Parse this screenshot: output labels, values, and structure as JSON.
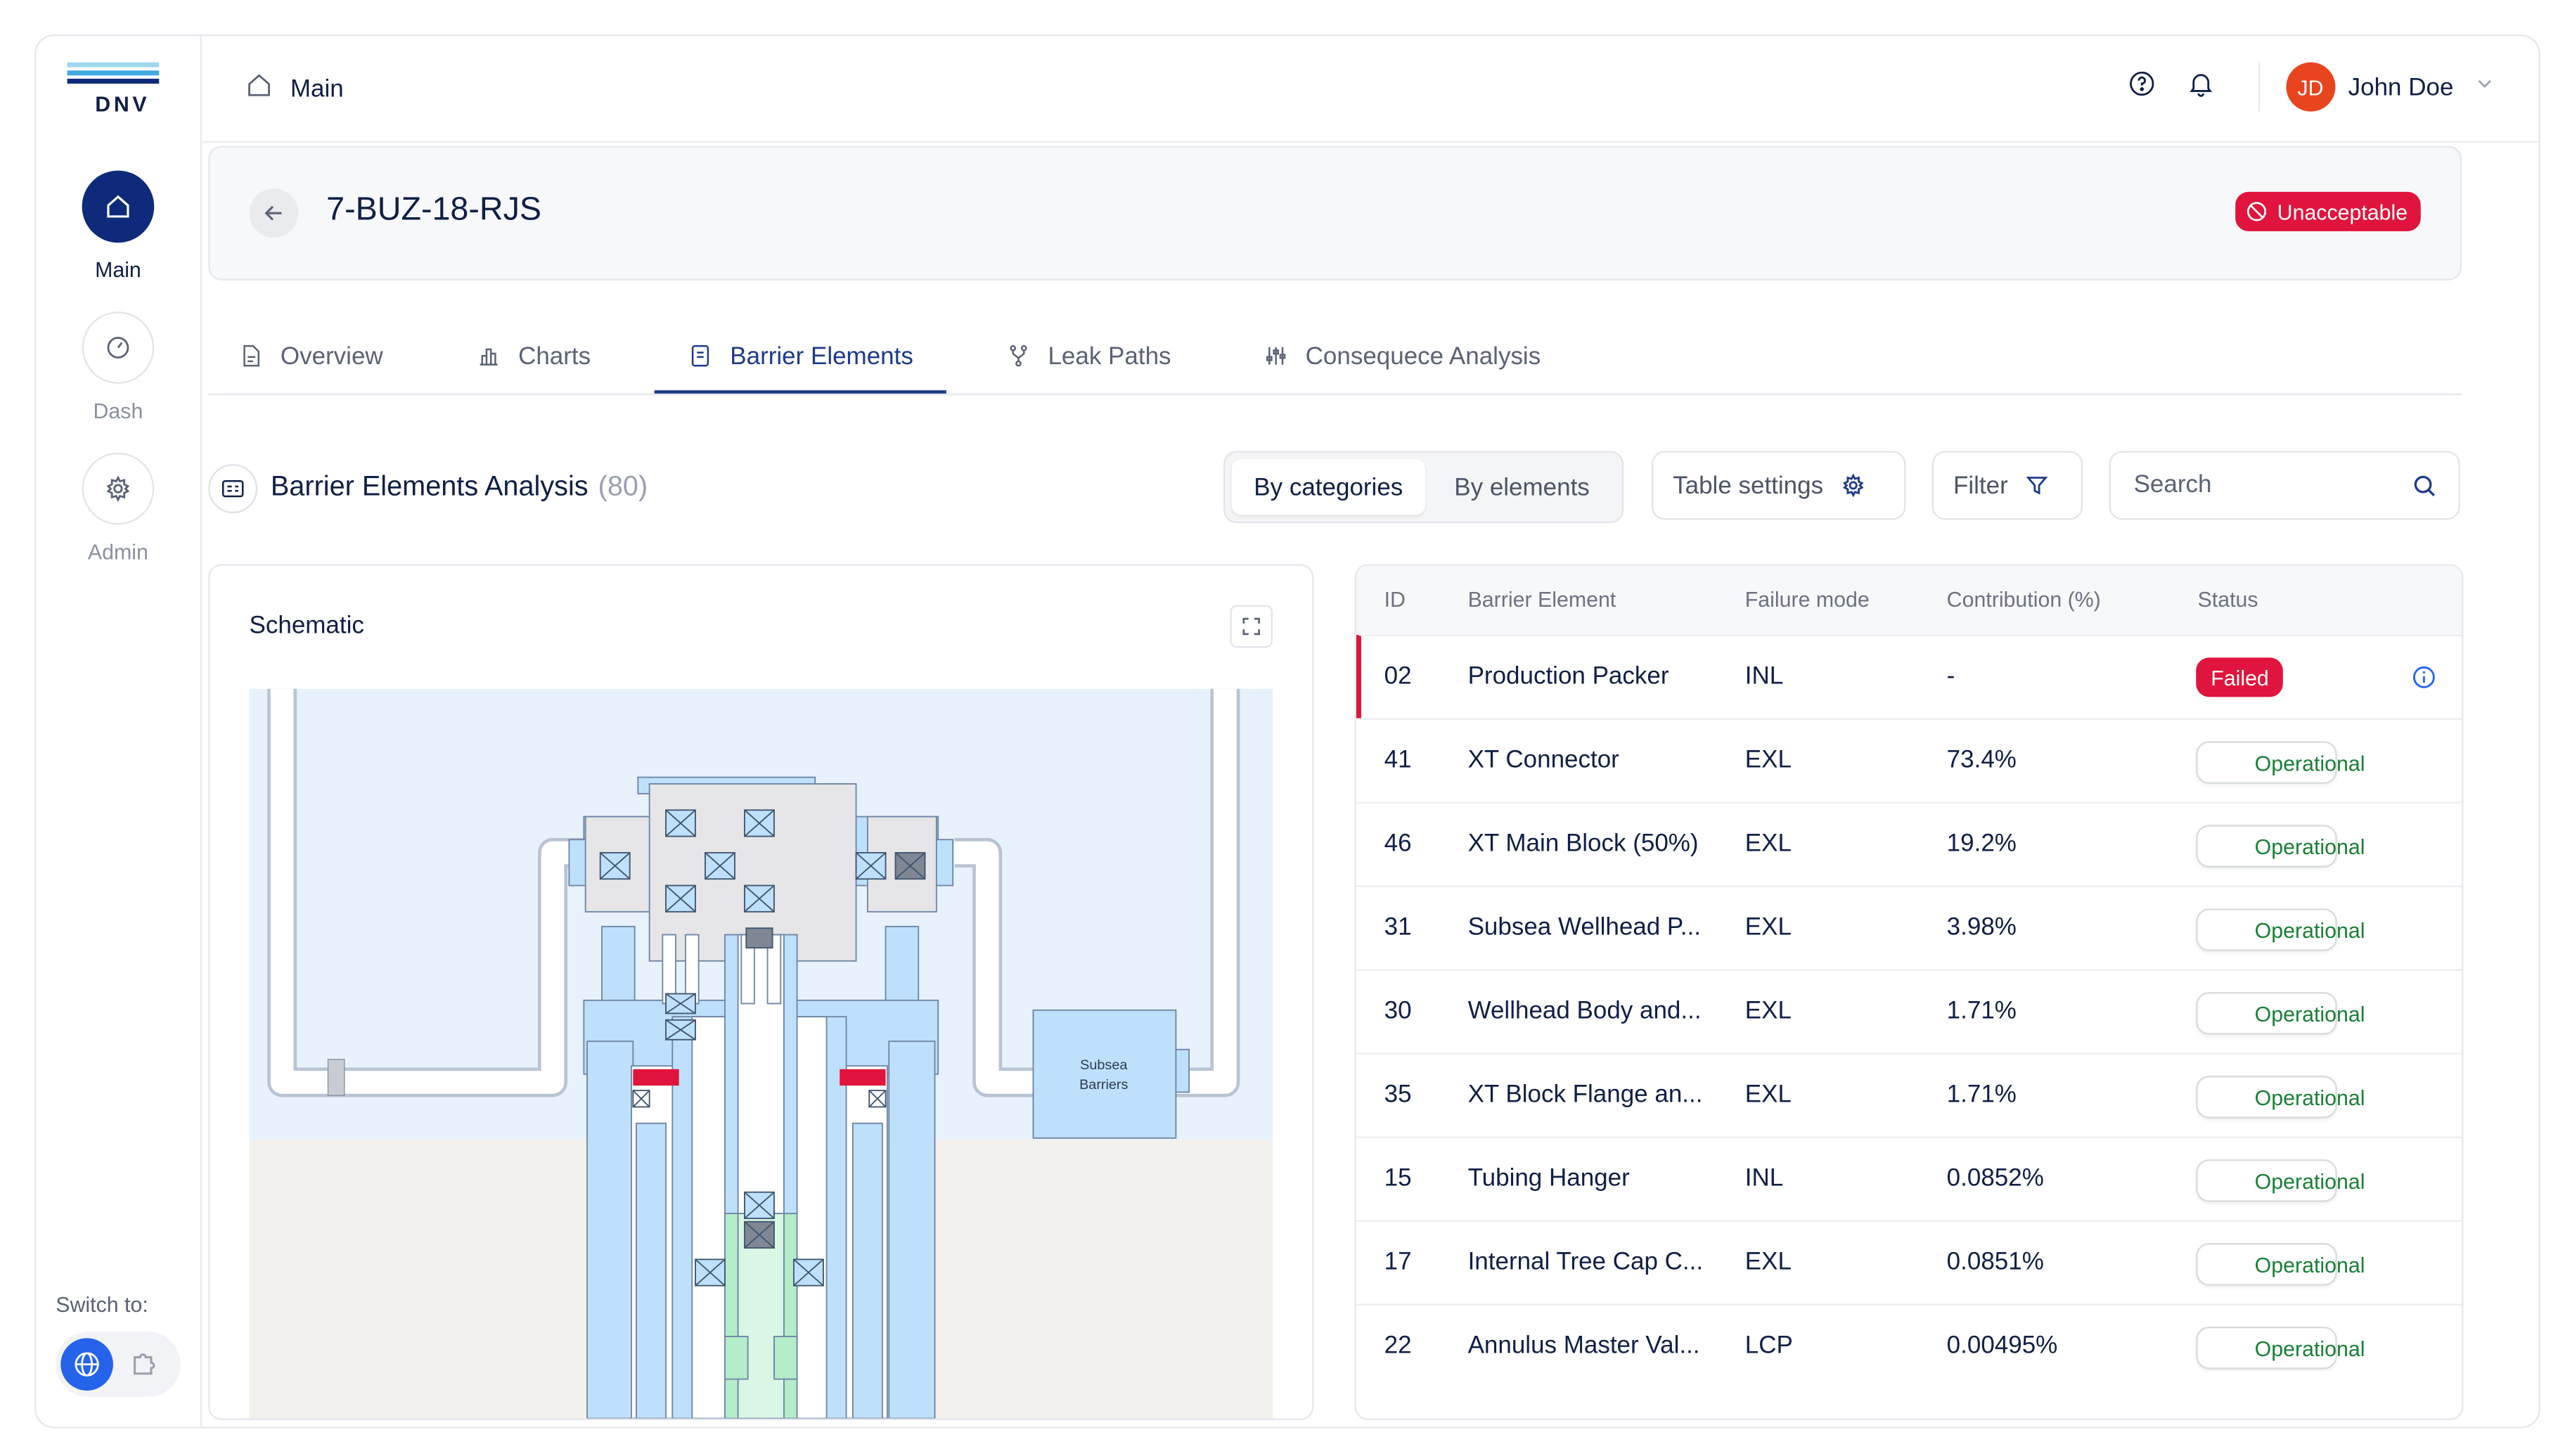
{
  "brand": {
    "logo_text": "DNV",
    "colors": {
      "navy": "#0f2a7a",
      "danger": "#e0143c",
      "success": "#1a7f37",
      "accent": "#e8451f"
    }
  },
  "sidebar": {
    "items": [
      {
        "label": "Main",
        "icon": "home-icon",
        "active": true
      },
      {
        "label": "Dash",
        "icon": "gauge-icon",
        "active": false
      },
      {
        "label": "Admin",
        "icon": "gear-icon",
        "active": false
      }
    ],
    "switch_label": "Switch to:"
  },
  "topbar": {
    "breadcrumb": "Main",
    "user": {
      "initials": "JD",
      "name": "John Doe"
    }
  },
  "well": {
    "title": "7-BUZ-18-RJS",
    "status": "Unacceptable"
  },
  "tabs": [
    {
      "label": "Overview",
      "icon": "document-icon"
    },
    {
      "label": "Charts",
      "icon": "bar-chart-icon"
    },
    {
      "label": "Barrier Elements",
      "icon": "list-icon",
      "active": true
    },
    {
      "label": "Leak Paths",
      "icon": "branch-icon"
    },
    {
      "label": "Consequece Analysis",
      "icon": "sliders-icon"
    }
  ],
  "section": {
    "title": "Barrier Elements Analysis",
    "count": "(80)",
    "toggle": {
      "selected": "By categories",
      "other": "By elements"
    },
    "table_settings": "Table settings",
    "filter": "Filter",
    "search_placeholder": "Search"
  },
  "schematic": {
    "title": "Schematic",
    "subsea_label_1": "Subsea",
    "subsea_label_2": "Barriers"
  },
  "table": {
    "columns": [
      "ID",
      "Barrier Element",
      "Failure mode",
      "Contribution (%)",
      "Status"
    ],
    "rows": [
      {
        "id": "02",
        "element": "Production Packer",
        "mode": "INL",
        "contribution": "-",
        "status": "Failed"
      },
      {
        "id": "41",
        "element": "XT Connector",
        "mode": "EXL",
        "contribution": "73.4%",
        "status": "Operational"
      },
      {
        "id": "46",
        "element": "XT Main Block (50%)",
        "mode": "EXL",
        "contribution": "19.2%",
        "status": "Operational"
      },
      {
        "id": "31",
        "element": "Subsea Wellhead P...",
        "mode": "EXL",
        "contribution": "3.98%",
        "status": "Operational"
      },
      {
        "id": "30",
        "element": "Wellhead Body and...",
        "mode": "EXL",
        "contribution": "1.71%",
        "status": "Operational"
      },
      {
        "id": "35",
        "element": "XT Block Flange an...",
        "mode": "EXL",
        "contribution": "1.71%",
        "status": "Operational"
      },
      {
        "id": "15",
        "element": "Tubing Hanger",
        "mode": "INL",
        "contribution": "0.0852%",
        "status": "Operational"
      },
      {
        "id": "17",
        "element": "Internal Tree Cap C...",
        "mode": "EXL",
        "contribution": "0.0851%",
        "status": "Operational"
      },
      {
        "id": "22",
        "element": "Annulus Master Val...",
        "mode": "LCP",
        "contribution": "0.00495%",
        "status": "Operational"
      }
    ]
  }
}
